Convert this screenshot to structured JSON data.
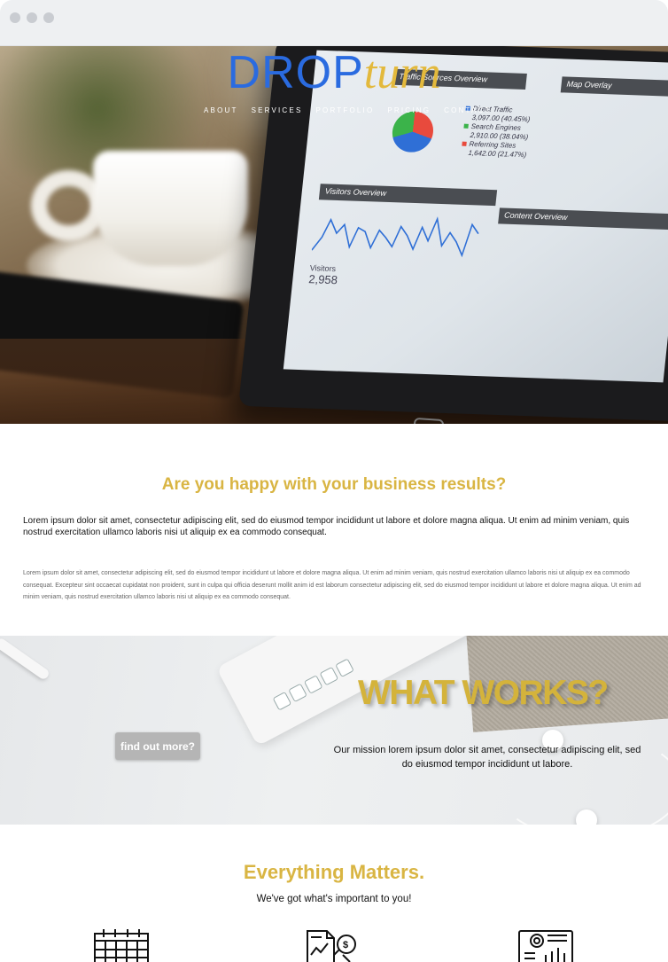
{
  "brand": {
    "part1": "DROP",
    "part2": "turn"
  },
  "nav": [
    "ABOUT",
    "SERVICES",
    "PORTFOLIO",
    "PRICING",
    "CONTACT"
  ],
  "hero_screen": {
    "panels": [
      "Traffic Sources Overview",
      "Map Overlay",
      "Visitors Overview",
      "Content Overview"
    ],
    "legend": [
      {
        "label": "Direct Traffic",
        "detail": "3,097.00 (40.45%)",
        "color": "#2f6fd6"
      },
      {
        "label": "Search Engines",
        "detail": "2,910.00 (38.04%)",
        "color": "#3bb34a"
      },
      {
        "label": "Referring Sites",
        "detail": "1,642.00 (21.47%)",
        "color": "#e84a3d"
      }
    ],
    "visitors_label": "Visitors",
    "visitors_value": "2,958"
  },
  "intro": {
    "title": "Are you happy with your business results?",
    "lead": "Lorem ipsum dolor sit amet, consectetur adipiscing elit, sed do eiusmod tempor incididunt ut labore et dolore magna aliqua. Ut enim ad minim veniam, quis nostrud exercitation ullamco laboris nisi ut aliquip ex ea commodo consequat.",
    "body": "Lorem ipsum dolor sit amet, consectetur adipiscing elit, sed do eiusmod tempor incididunt ut labore et dolore magna aliqua. Ut enim ad minim veniam, quis nostrud exercitation ullamco laboris nisi ut aliquip ex ea commodo consequat. Excepteur sint occaecat cupidatat non proident, sunt in culpa qui officia deserunt mollit anim id est laborum consectetur adipiscing elit, sed do eiusmod tempor incididunt ut labore et dolore magna aliqua. Ut enim ad minim veniam, quis nostrud exercitation ullamco laboris nisi ut aliquip ex ea commodo consequat."
  },
  "works": {
    "title": "WHAT WORKS?",
    "button": "find out more?",
    "mission": "Our mission lorem ipsum dolor sit amet, consectetur adipiscing elit, sed do eiusmod tempor incididunt ut labore."
  },
  "matters": {
    "title": "Everything Matters.",
    "subtitle": "We've got what's important to you!",
    "icons": [
      "calendar-icon",
      "invoice-icon",
      "analytics-report-icon"
    ]
  },
  "colors": {
    "accent": "#d9b543",
    "brand_blue": "#2a6be0",
    "button_gray": "#b5b5b5"
  }
}
